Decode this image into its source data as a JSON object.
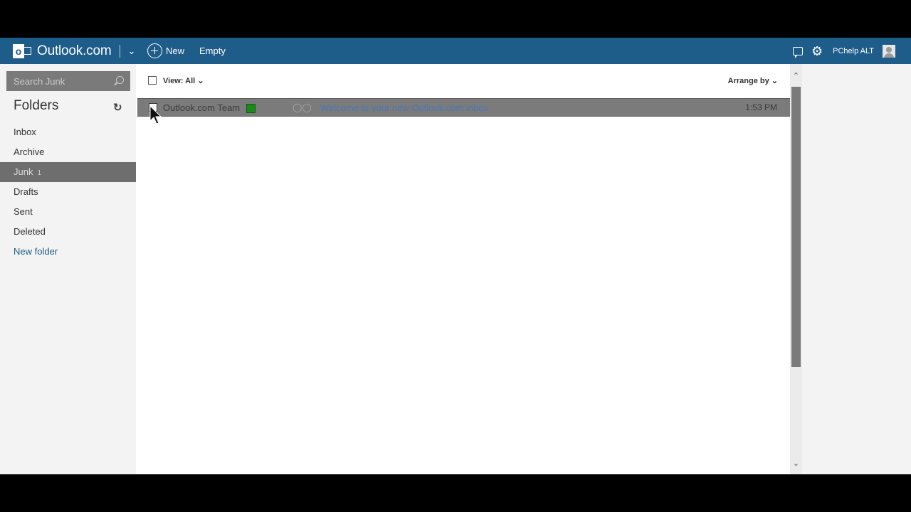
{
  "topbar": {
    "brand": "Outlook.com",
    "new_label": "New",
    "empty_label": "Empty",
    "user_name": "PChelp ALT"
  },
  "sidebar": {
    "search_placeholder": "Search Junk",
    "folders_title": "Folders",
    "items": [
      {
        "label": "Inbox",
        "count": ""
      },
      {
        "label": "Archive",
        "count": ""
      },
      {
        "label": "Junk",
        "count": "1"
      },
      {
        "label": "Drafts",
        "count": ""
      },
      {
        "label": "Sent",
        "count": ""
      },
      {
        "label": "Deleted",
        "count": ""
      }
    ],
    "new_folder_label": "New folder"
  },
  "list": {
    "view_label": "View: All",
    "arrange_label": "Arrange by",
    "messages": [
      {
        "sender": "Outlook.com Team",
        "subject": "Welcome to your new Outlook.com inbox",
        "date": "1:53 PM"
      }
    ]
  },
  "colors": {
    "brand_bar": "#1e5c8a",
    "selected_row": "#7b7b7b",
    "active_folder": "#6e6e6e"
  }
}
